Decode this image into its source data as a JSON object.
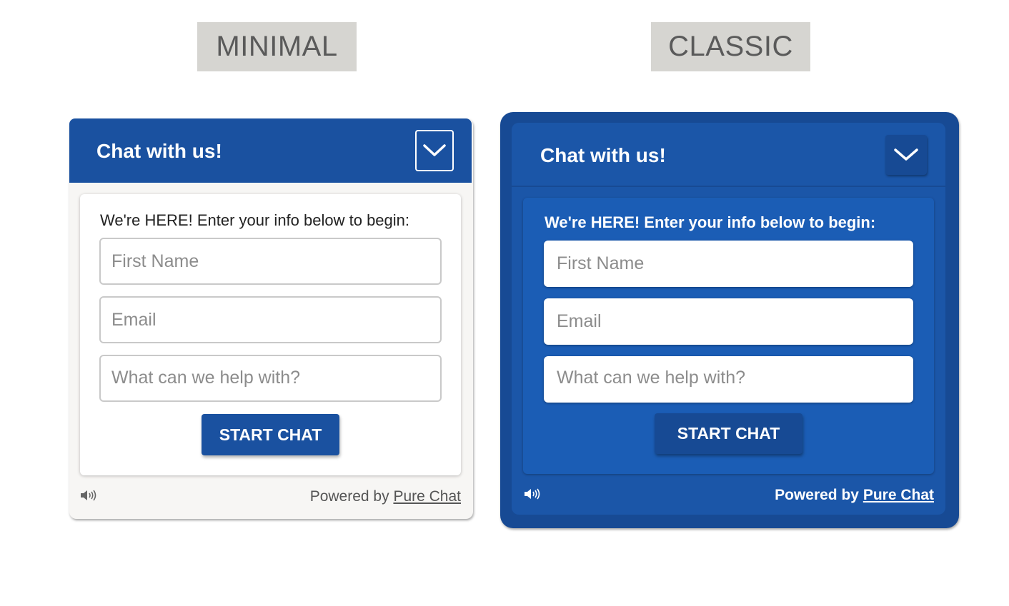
{
  "labels": {
    "minimal": "MINIMAL",
    "classic": "CLASSIC"
  },
  "minimal": {
    "header_title": "Chat with us!",
    "collapse_icon": "chevron-down-icon",
    "intro": "We're HERE! Enter your info below to begin:",
    "first_name_placeholder": "First Name",
    "email_placeholder": "Email",
    "message_placeholder": "What can we help with?",
    "start_label": "START CHAT",
    "sound_icon": "speaker-icon",
    "powered_prefix": "Powered by",
    "powered_link": "Pure Chat"
  },
  "classic": {
    "header_title": "Chat with us!",
    "collapse_icon": "chevron-down-icon",
    "intro": "We're HERE! Enter your info below to begin:",
    "first_name_placeholder": "First Name",
    "email_placeholder": "Email",
    "message_placeholder": "What can we help with?",
    "start_label": "START CHAT",
    "sound_icon": "speaker-icon",
    "powered_prefix": "Powered by",
    "powered_link": "Pure Chat"
  },
  "colors": {
    "brand_blue": "#1a51a0",
    "classic_frame": "#174a94",
    "classic_card": "#1b5db5",
    "label_bg": "#d6d5d1"
  }
}
